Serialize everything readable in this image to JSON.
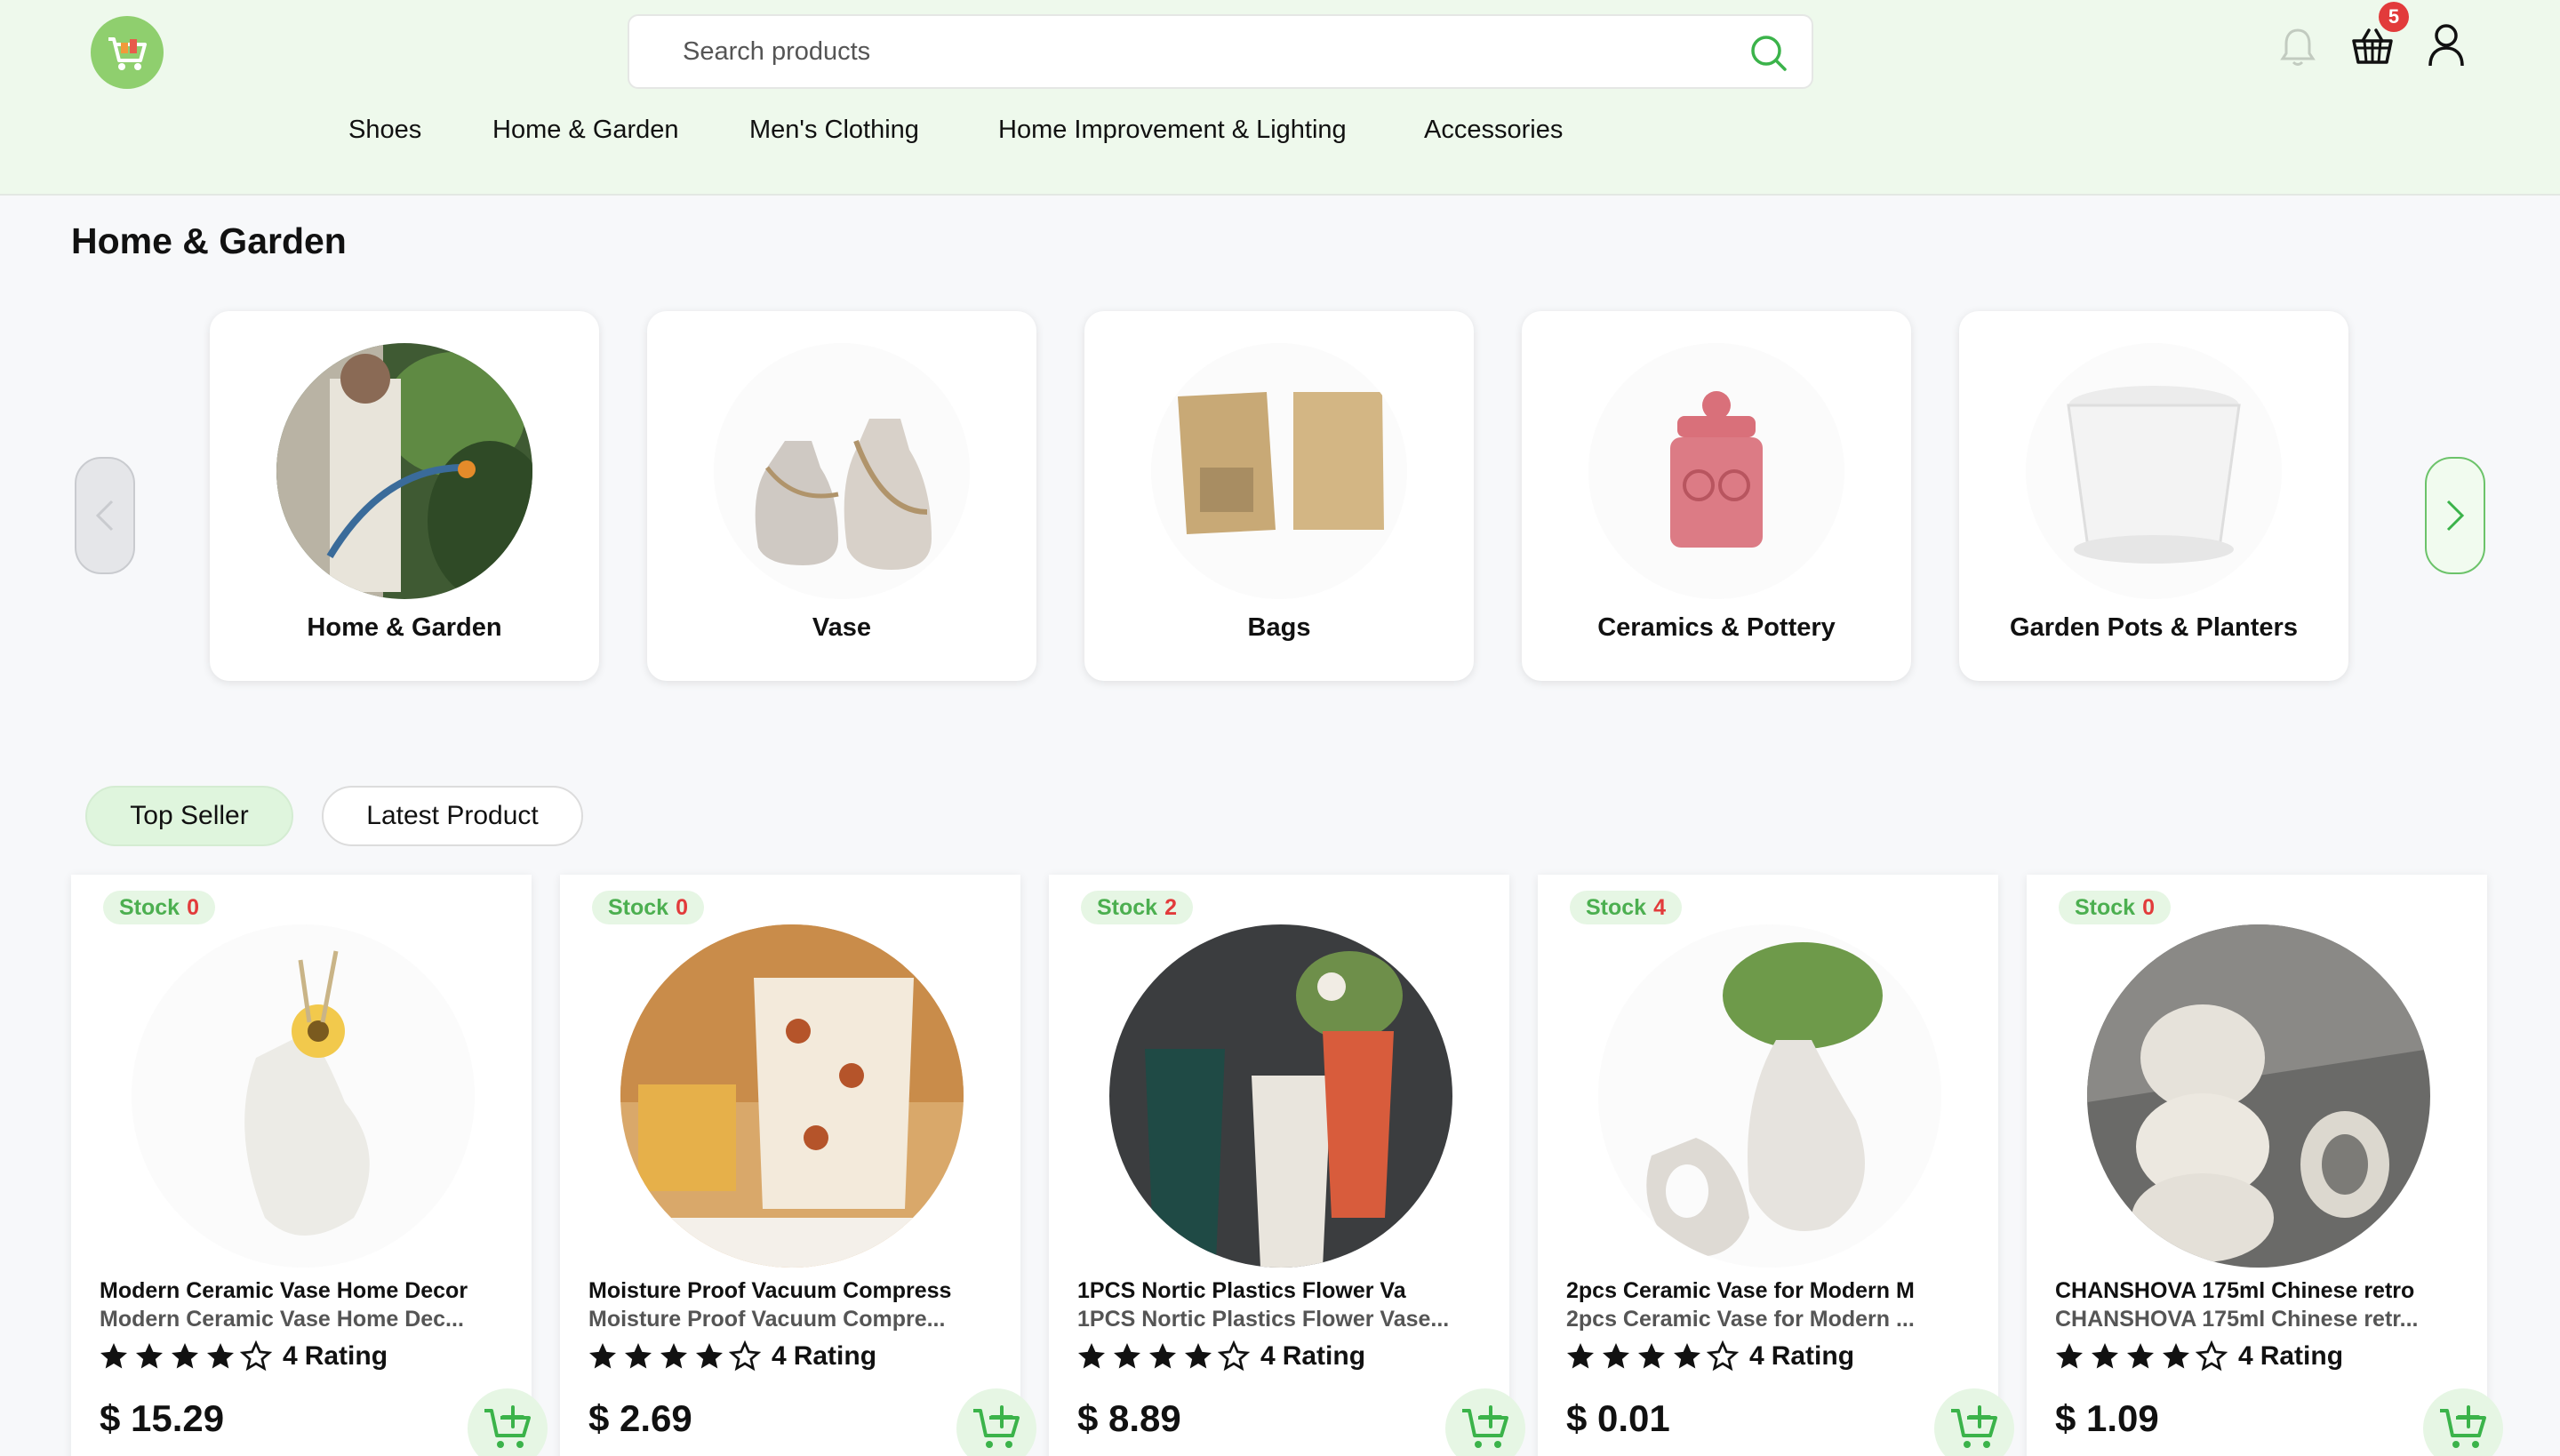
{
  "header": {
    "search_placeholder": "Search products",
    "cart_count": "5",
    "nav": [
      {
        "label": "Shoes"
      },
      {
        "label": "Home & Garden"
      },
      {
        "label": "Men's Clothing"
      },
      {
        "label": "Home Improvement & Lighting"
      },
      {
        "label": "Accessories"
      }
    ]
  },
  "section_title": "Home & Garden",
  "categories": [
    {
      "label": "Home & Garden"
    },
    {
      "label": "Vase"
    },
    {
      "label": "Bags"
    },
    {
      "label": "Ceramics & Pottery"
    },
    {
      "label": "Garden Pots & Planters"
    }
  ],
  "tabs": {
    "top_seller": "Top Seller",
    "latest_product": "Latest Product"
  },
  "stock_label": "Stock",
  "rating_label": "Rating",
  "products": [
    {
      "stock": "0",
      "title": "Modern Ceramic Vase Home Decor",
      "subtitle": "Modern Ceramic Vase Home Dec...",
      "rating": "4",
      "price": "$ 15.29"
    },
    {
      "stock": "0",
      "title": "Moisture Proof Vacuum Compress",
      "subtitle": "Moisture Proof Vacuum Compre...",
      "rating": "4",
      "price": "$ 2.69"
    },
    {
      "stock": "2",
      "title": "1PCS Nortic Plastics Flower Va",
      "subtitle": "1PCS Nortic Plastics Flower Vase...",
      "rating": "4",
      "price": "$ 8.89"
    },
    {
      "stock": "4",
      "title": "2pcs Ceramic Vase for Modern M",
      "subtitle": "2pcs Ceramic Vase for Modern ...",
      "rating": "4",
      "price": "$ 0.01"
    },
    {
      "stock": "0",
      "title": "CHANSHOVA 175ml Chinese retro",
      "subtitle": "CHANSHOVA 175ml Chinese retr...",
      "rating": "4",
      "price": "$ 1.09"
    }
  ],
  "colors": {
    "accent_green": "#4caf50",
    "header_bg": "#eef9ec",
    "badge_red": "#e23b3b"
  }
}
